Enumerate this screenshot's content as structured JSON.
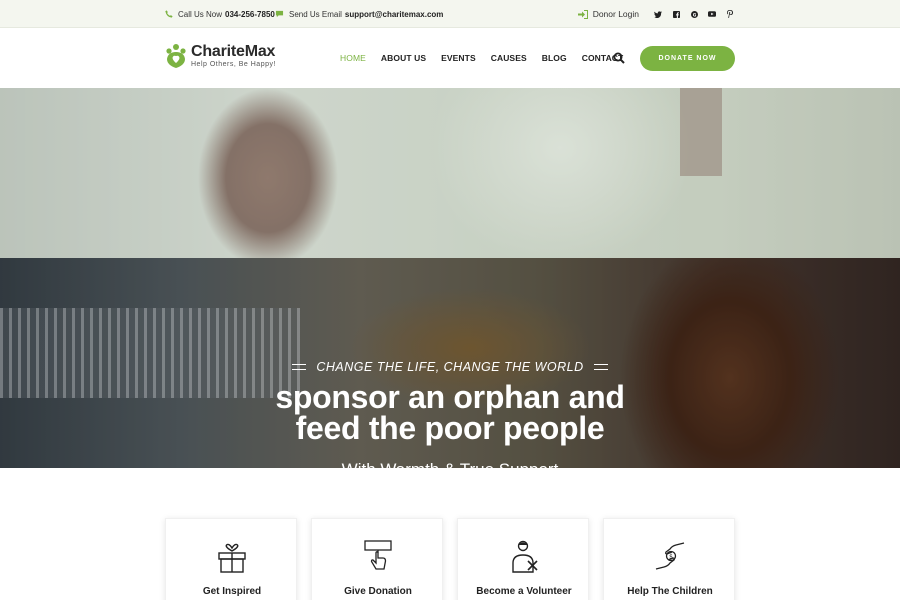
{
  "topbar": {
    "call_label": "Call Us Now",
    "call_value": "034-256-7850",
    "email_label": "Send Us Email",
    "email_value": "support@charitemax.com",
    "donor_login": "Donor Login",
    "social_icons": [
      "twitter-icon",
      "facebook-icon",
      "google-plus-icon",
      "youtube-icon",
      "pinterest-icon"
    ]
  },
  "brand": {
    "name": "ChariteMax",
    "tagline": "Help Others, Be Happy!",
    "accent_color": "#7cb342"
  },
  "nav": {
    "items": [
      {
        "label": "HOME",
        "active": true
      },
      {
        "label": "ABOUT US",
        "active": false
      },
      {
        "label": "EVENTS",
        "active": false
      },
      {
        "label": "CAUSES",
        "active": false
      },
      {
        "label": "BLOG",
        "active": false
      },
      {
        "label": "CONTACT",
        "active": false
      }
    ],
    "donate_label": "DONATE NOW"
  },
  "hero": {
    "tagline": "CHANGE THE LIFE, CHANGE THE WORLD",
    "headline_line1": "sponsor an orphan and",
    "headline_line2": "feed the poor people",
    "subline": "With Warmth & True Support"
  },
  "features": [
    {
      "title": "Get Inspired",
      "icon": "gift-box-heart-icon"
    },
    {
      "title": "Give Donation",
      "icon": "donate-hand-icon"
    },
    {
      "title": "Become a Volunteer",
      "icon": "volunteer-icon"
    },
    {
      "title": "Help The Children",
      "icon": "helping-hands-icon"
    }
  ]
}
